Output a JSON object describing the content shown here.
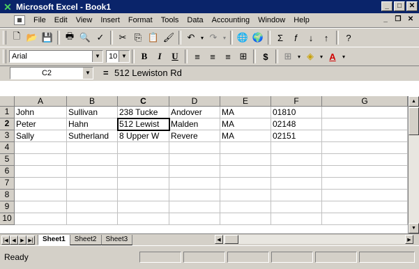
{
  "window": {
    "title": "Microsoft Excel - Book1"
  },
  "menubar": {
    "items": [
      "File",
      "Edit",
      "View",
      "Insert",
      "Format",
      "Tools",
      "Data",
      "Accounting",
      "Window",
      "Help"
    ]
  },
  "toolbar": {
    "font_name": "Arial",
    "font_size": "10",
    "bold_label": "B",
    "italic_label": "I",
    "underline_label": "U",
    "currency_label": "$"
  },
  "formula_bar": {
    "name_box": "C2",
    "equals": "=",
    "content": "512 Lewiston Rd"
  },
  "sheet": {
    "columns": [
      "A",
      "B",
      "C",
      "D",
      "E",
      "F",
      "G"
    ],
    "rows": [
      "1",
      "2",
      "3",
      "4",
      "5",
      "6",
      "7",
      "8",
      "9",
      "10"
    ],
    "cells": [
      [
        "John",
        "Sullivan",
        "238 Tucke",
        "Andover",
        "MA",
        "01810",
        ""
      ],
      [
        "Peter",
        "Hahn",
        "512 Lewist",
        "Malden",
        "MA",
        "02148",
        ""
      ],
      [
        "Sally",
        "Sutherland",
        "8 Upper W",
        "Revere",
        "MA",
        "02151",
        ""
      ]
    ],
    "selected_cell": "C2"
  },
  "tabs": [
    "Sheet1",
    "Sheet2",
    "Sheet3"
  ],
  "status": {
    "text": "Ready"
  }
}
